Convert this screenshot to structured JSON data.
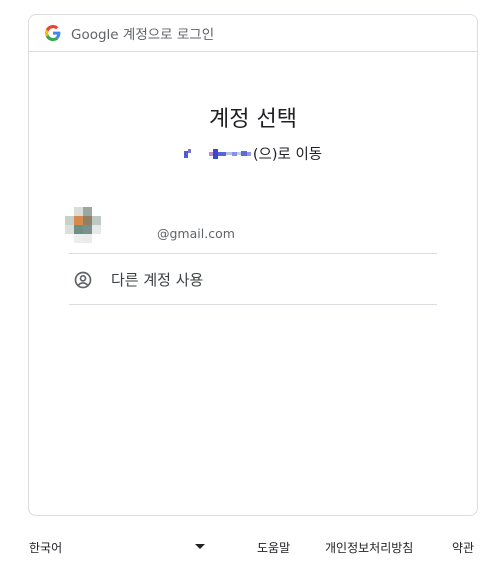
{
  "header": {
    "text": "Google 계정으로 로그인"
  },
  "main": {
    "title": "계정 선택",
    "subtitle_suffix": "(으)로 이동"
  },
  "accounts": [
    {
      "email": "@gmail.com"
    }
  ],
  "other_account": {
    "label": "다른 계정 사용"
  },
  "footer": {
    "language": "한국어",
    "help": "도움말",
    "privacy": "개인정보처리방침",
    "terms": "약관"
  },
  "colors": {
    "border": "#dadce0",
    "text_secondary": "#5f6368",
    "google_blue": "#4285f4",
    "google_red": "#ea4335",
    "google_yellow": "#fbbc05",
    "google_green": "#34a853"
  },
  "icons": {
    "header_logo": "google-g-icon",
    "other_account": "account-circle-icon",
    "language_dropdown": "caret-down-icon"
  }
}
